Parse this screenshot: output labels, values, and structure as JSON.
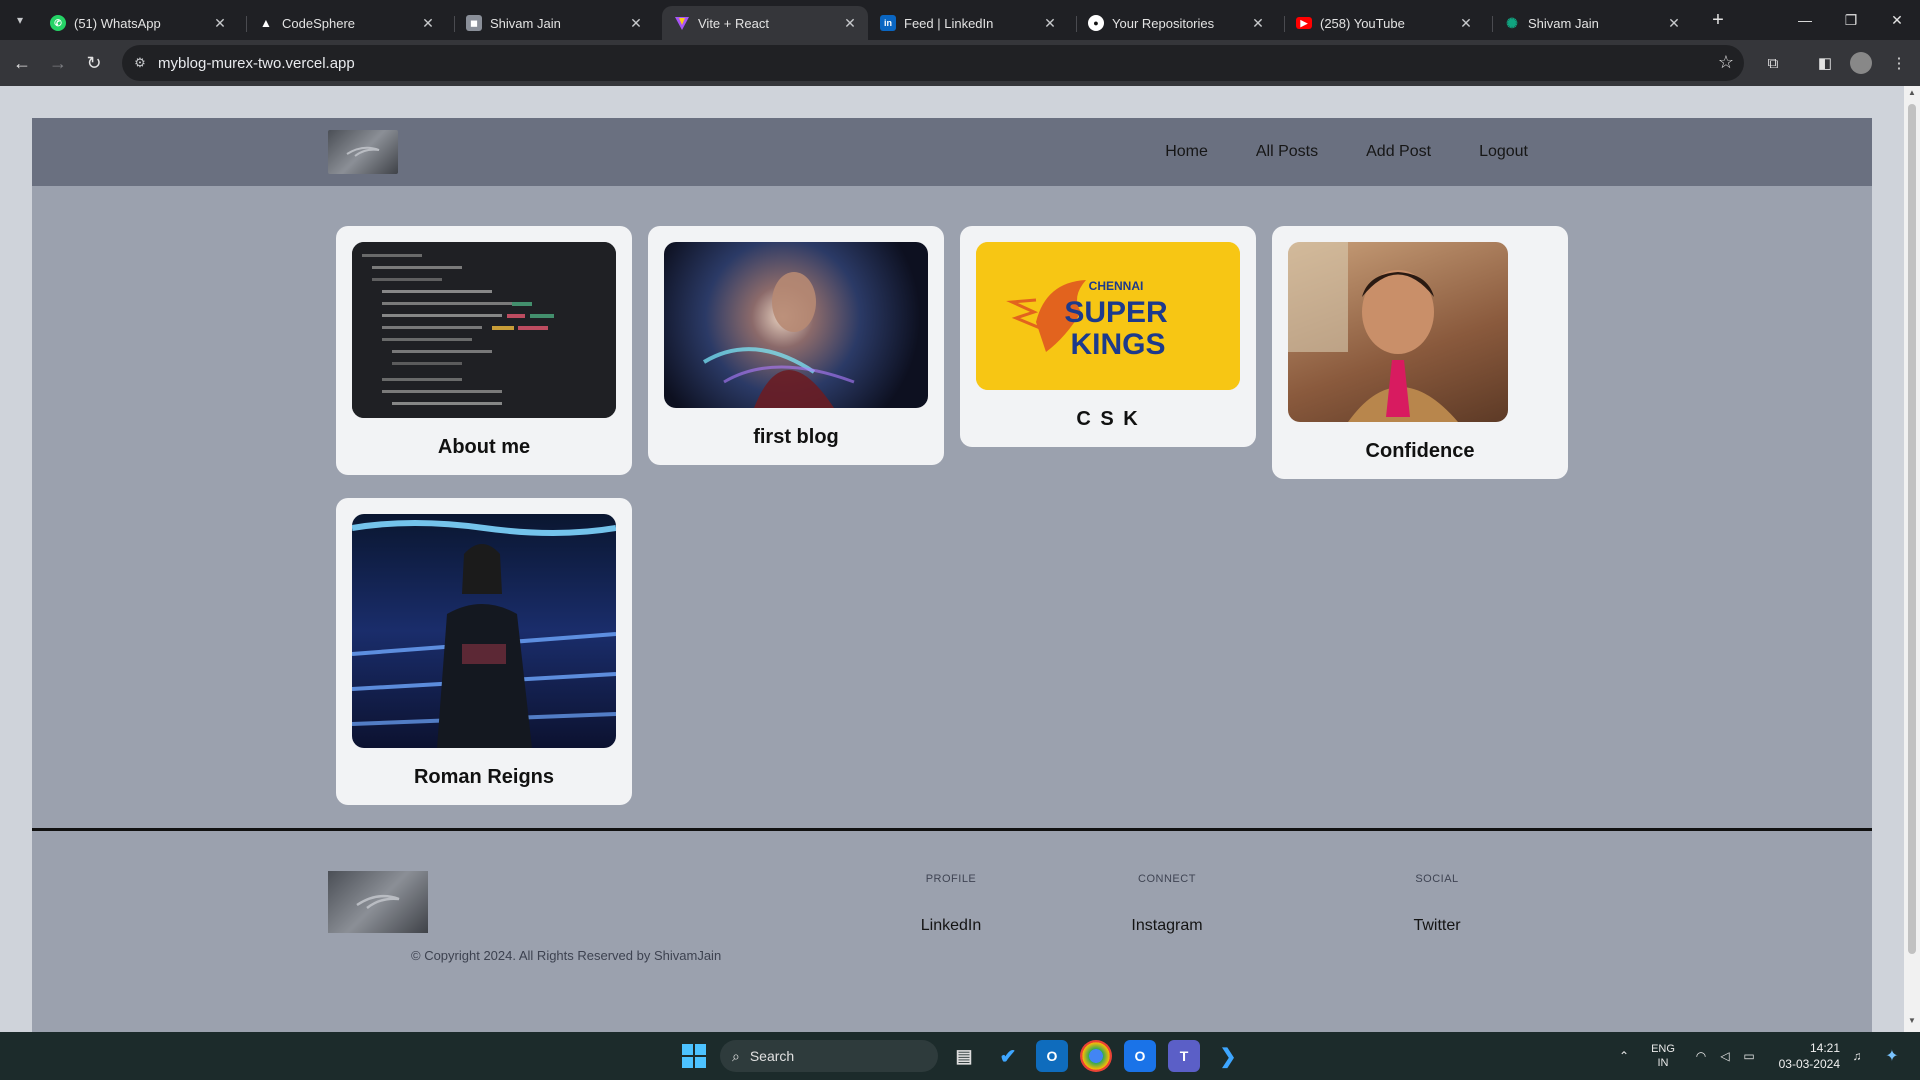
{
  "browser": {
    "tabs": [
      {
        "title": "(51) WhatsApp",
        "icon": "whatsapp-icon",
        "color": "#25d366",
        "active": false
      },
      {
        "title": "CodeSphere",
        "icon": "codesphere-icon",
        "color": "#ffffff",
        "active": false
      },
      {
        "title": "Shivam Jain",
        "icon": "portrait-icon",
        "color": "#8a8f99",
        "active": false
      },
      {
        "title": "Vite + React",
        "icon": "vite-icon",
        "color": "#a855f7",
        "active": true
      },
      {
        "title": "Feed | LinkedIn",
        "icon": "linkedin-icon",
        "color": "#0a66c2",
        "active": false
      },
      {
        "title": "Your Repositories",
        "icon": "github-icon",
        "color": "#ffffff",
        "active": false
      },
      {
        "title": "(258) YouTube",
        "icon": "youtube-icon",
        "color": "#ff0000",
        "active": false
      },
      {
        "title": "Shivam Jain",
        "icon": "openai-icon",
        "color": "#10a37f",
        "active": false
      }
    ],
    "url": "myblog-murex-two.vercel.app"
  },
  "site": {
    "nav": [
      "Home",
      "All Posts",
      "Add Post",
      "Logout"
    ],
    "posts": [
      {
        "title": "About me",
        "image": "code-editor-photo"
      },
      {
        "title": "first blog",
        "image": "doctor-strange-photo"
      },
      {
        "title": "C S K",
        "image": "chennai-super-kings-logo",
        "logo_lines": [
          "CHENNAI",
          "SUPER",
          "KINGS"
        ]
      },
      {
        "title": "Confidence",
        "image": "smiling-boy-photo"
      },
      {
        "title": "Roman Reigns",
        "image": "wrestler-photo"
      }
    ],
    "footer": {
      "copyright": "© Copyright 2024. All Rights Reserved by ShivamJain",
      "columns": [
        {
          "heading": "PROFILE",
          "link": "LinkedIn"
        },
        {
          "heading": "CONNECT",
          "link": "Instagram"
        },
        {
          "heading": "SOCIAL",
          "link": "Twitter"
        }
      ]
    }
  },
  "taskbar": {
    "search_label": "Search",
    "language": [
      "ENG",
      "IN"
    ],
    "time": "14:21",
    "date": "03-03-2024"
  }
}
